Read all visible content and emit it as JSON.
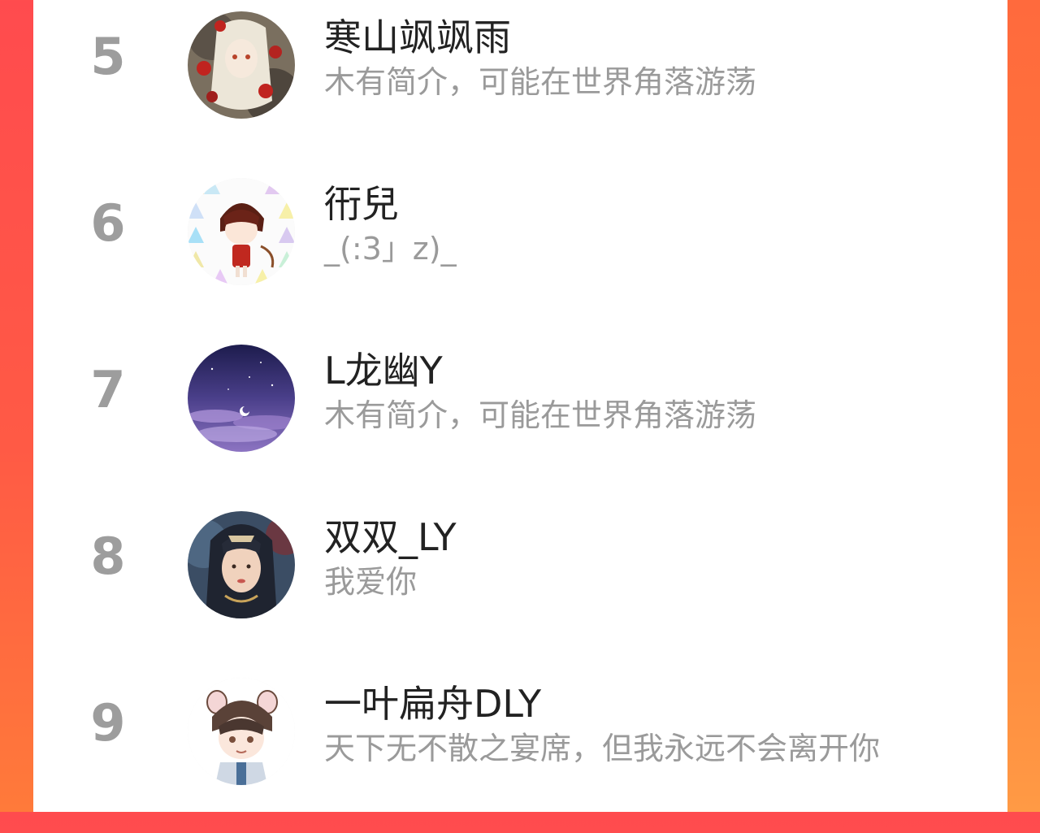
{
  "ranking": {
    "items": [
      {
        "rank": "5",
        "name": "寒山飒飒雨",
        "bio": "木有简介，可能在世界角落游荡"
      },
      {
        "rank": "6",
        "name": "衎兒",
        "bio": "_(:3」z)_"
      },
      {
        "rank": "7",
        "name": "L龙幽Y",
        "bio": "木有简介，可能在世界角落游荡"
      },
      {
        "rank": "8",
        "name": "双双_LY",
        "bio": "我爱你"
      },
      {
        "rank": "9",
        "name": "一叶扁舟DLY",
        "bio": "天下无不散之宴席，但我永远不会离开你"
      }
    ]
  }
}
